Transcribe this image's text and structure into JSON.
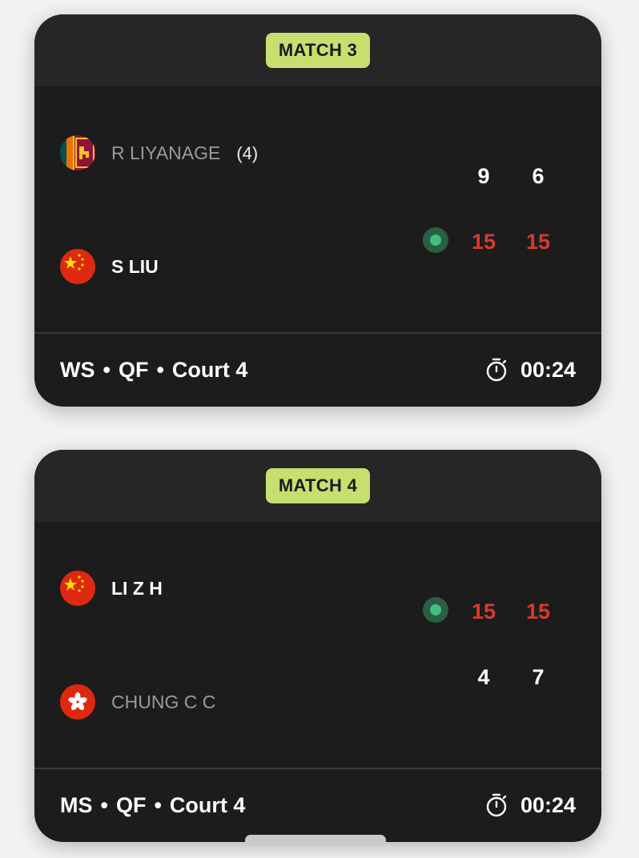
{
  "matches": [
    {
      "label": "MATCH 3",
      "players": [
        {
          "name": "R LIYANAGE",
          "seed": "(4)",
          "flag": "sri-lanka-flag-icon",
          "status": "loser",
          "scores": [
            "9",
            "6"
          ]
        },
        {
          "name": "S LIU",
          "seed": "",
          "flag": "china-flag-icon",
          "status": "winner",
          "scores": [
            "15",
            "15"
          ]
        }
      ],
      "event": "WS",
      "round": "QF",
      "court": "Court 4",
      "separator": "•",
      "timer_icon": "stopwatch-icon",
      "duration": "00:24"
    },
    {
      "label": "MATCH 4",
      "players": [
        {
          "name": "LI Z H",
          "seed": "",
          "flag": "china-flag-icon",
          "status": "winner",
          "scores": [
            "15",
            "15"
          ]
        },
        {
          "name": "CHUNG C C",
          "seed": "",
          "flag": "hong-kong-flag-icon",
          "status": "loser",
          "scores": [
            "4",
            "7"
          ]
        }
      ],
      "event": "MS",
      "round": "QF",
      "court": "Court 4",
      "separator": "•",
      "timer_icon": "stopwatch-icon",
      "duration": "00:24"
    }
  ],
  "colors": {
    "card_bg": "#1c1c1c",
    "header_bg": "#262626",
    "badge": "#c6df6f",
    "winner_score": "#d93a2b",
    "serve_indicator": "#41c07b"
  }
}
